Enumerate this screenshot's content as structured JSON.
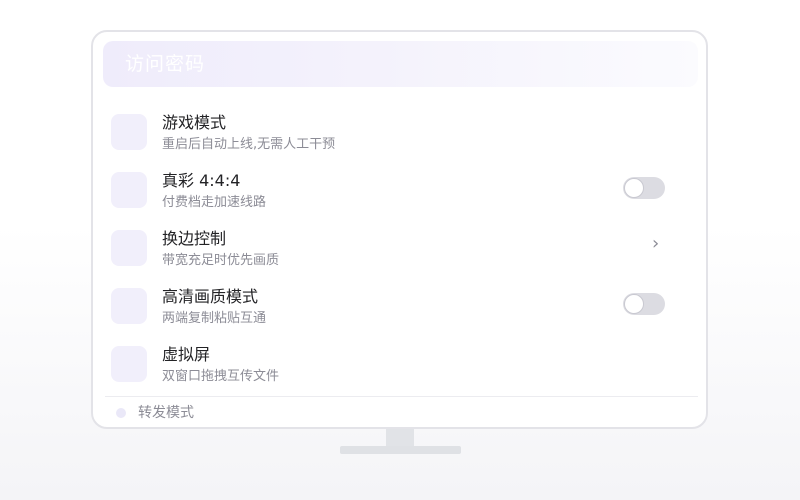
{
  "header": {
    "title": "访问密码"
  },
  "settings": [
    {
      "title": "游戏模式",
      "subtitle": "重启后自动上线,无需人工干预",
      "control": "none"
    },
    {
      "title": "真彩 4:4:4",
      "subtitle": "付费档走加速线路",
      "control": "toggle",
      "enabled": false
    },
    {
      "title": "换边控制",
      "subtitle": "带宽充足时优先画质",
      "control": "chevron",
      "chevron": "›"
    },
    {
      "title": "高清画质模式",
      "subtitle": "两端复制粘贴互通",
      "control": "toggle",
      "enabled": false
    },
    {
      "title": "虚拟屏",
      "subtitle": "双窗口拖拽互传文件",
      "control": "none"
    }
  ],
  "footer": {
    "label": "转发模式"
  },
  "colors": {
    "accent_light": "#f1effb",
    "toggle_off": "#dcdce2",
    "title_text": "#232326",
    "subtitle_text": "#8c8c96",
    "border": "#e3e3e8"
  }
}
